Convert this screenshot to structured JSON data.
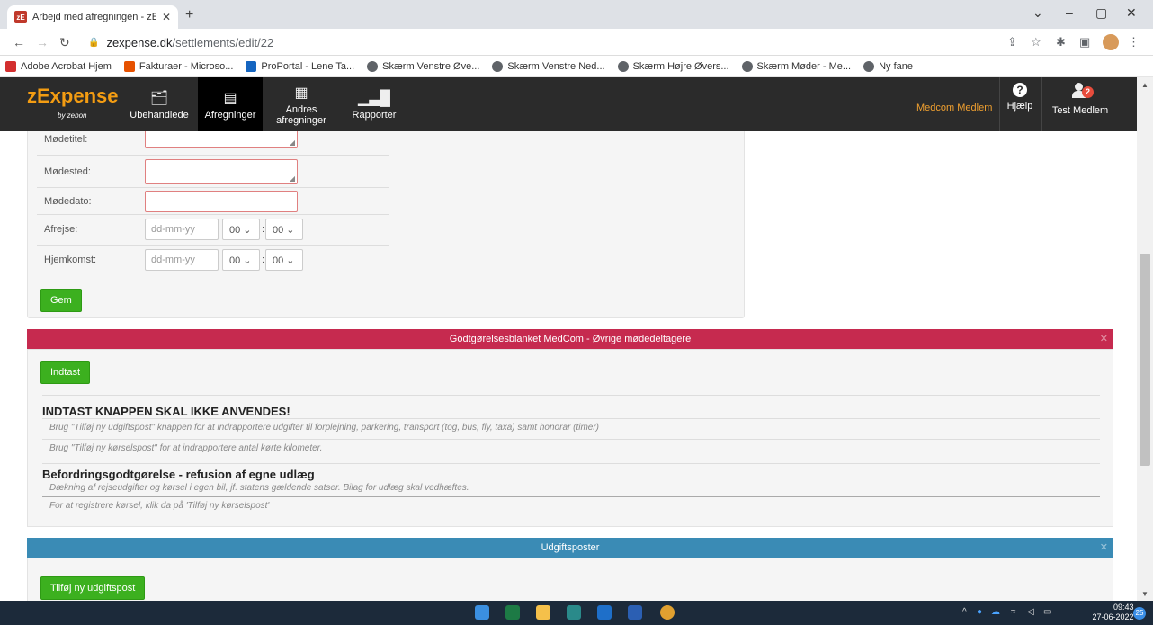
{
  "browser": {
    "tab_title": "Arbejd med afregningen - zExper",
    "tab_close": "✕",
    "new_tab": "+",
    "url_host": "zexpense.dk",
    "url_path": "/settlements/edit/22",
    "bookmarks": [
      {
        "label": "Adobe Acrobat Hjem",
        "color": "#d32f2f"
      },
      {
        "label": "Fakturaer - Microso...",
        "color": "#e65100"
      },
      {
        "label": "ProPortal - Lene Ta...",
        "color": "#1565c0"
      },
      {
        "label": "Skærm Venstre Øve...",
        "color": "globe"
      },
      {
        "label": "Skærm Venstre Ned...",
        "color": "globe"
      },
      {
        "label": "Skærm Højre Øvers...",
        "color": "globe"
      },
      {
        "label": "Skærm Møder - Me...",
        "color": "globe"
      },
      {
        "label": "Ny fane",
        "color": "globe"
      }
    ]
  },
  "app": {
    "logo": "zExpense",
    "logo_sub": "by zebon",
    "nav": [
      {
        "label": "Ubehandlede",
        "icon": "receipt-icon"
      },
      {
        "label": "Afregninger",
        "icon": "document-icon"
      },
      {
        "label": "Andres afregninger",
        "icon": "documents-icon"
      },
      {
        "label": "Rapporter",
        "icon": "chart-icon"
      }
    ],
    "company": "Medcom Medlem",
    "help": "Hjælp",
    "help_glyph": "?",
    "user": "Test Medlem",
    "user_badge": "2"
  },
  "form": {
    "fields": {
      "title": "Mødetitel:",
      "place": "Mødested:",
      "date": "Mødedato:",
      "departure": "Afrejse:",
      "return": "Hjemkomst:"
    },
    "date_placeholder": "dd-mm-yy",
    "hour": "00",
    "minute": "00",
    "time_sep": ":",
    "save": "Gem"
  },
  "section1": {
    "title": "Godtgørelsesblanket MedCom - Øvrige mødedeltagere",
    "color": "#c62a4f",
    "button": "Indtast",
    "warning": "INDTAST KNAPPEN SKAL IKKE ANVENDES!",
    "note1": "Brug \"Tilføj ny udgiftspost\" knappen for at indrapportere udgifter til forplejning, parkering, transport (tog, bus, fly, taxa) samt honorar (timer)",
    "note2": "Brug \"Tilføj ny kørselspost\" for at indrapportere antal kørte kilometer.",
    "heading2": "Befordringsgodtgørelse - refusion af egne udlæg",
    "note3": "Dækning af rejseudgifter og kørsel i egen bil, jf. statens gældende satser. Bilag for udlæg skal vedhæftes.",
    "note4": "For at registrere kørsel, klik da på 'Tilføj ny kørselspost'"
  },
  "section2": {
    "title": "Udgiftsposter",
    "color": "#3a8bb5",
    "button": "Tilføj ny udgiftspost"
  },
  "taskbar": {
    "time": "09:43",
    "date": "27-06-2022",
    "notif_count": "25"
  }
}
